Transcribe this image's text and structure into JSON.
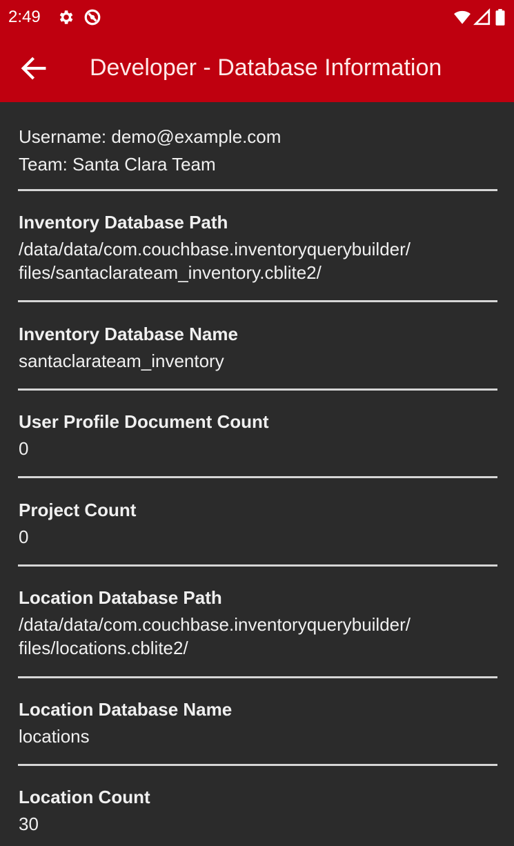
{
  "status_bar": {
    "time": "2:49",
    "icons": [
      "gear-icon",
      "no-data-icon",
      "wifi-icon",
      "signal-icon",
      "battery-icon"
    ]
  },
  "toolbar": {
    "title": "Developer - Database Information",
    "back_icon": "arrow-left-icon"
  },
  "colors": {
    "toolbar_bg": "#bf000f",
    "content_bg": "#2b2b2b",
    "divider": "#d6d6d6"
  },
  "user": {
    "username_line": "Username: demo@example.com",
    "team_line": "Team: Santa Clara Team"
  },
  "sections": [
    {
      "label": "Inventory Database Path",
      "value_lines": [
        "/data/data/com.couchbase.inventoryquerybuilder/",
        "files/santaclarateam_inventory.cblite2/"
      ]
    },
    {
      "label": "Inventory Database Name",
      "value_lines": [
        "santaclarateam_inventory"
      ]
    },
    {
      "label": "User Profile Document Count",
      "value_lines": [
        "0"
      ]
    },
    {
      "label": "Project Count",
      "value_lines": [
        "0"
      ]
    },
    {
      "label": "Location Database Path",
      "value_lines": [
        "/data/data/com.couchbase.inventoryquerybuilder/",
        "files/locations.cblite2/"
      ]
    },
    {
      "label": "Location Database Name",
      "value_lines": [
        "locations"
      ]
    },
    {
      "label": "Location Count",
      "value_lines": [
        "30"
      ]
    }
  ]
}
